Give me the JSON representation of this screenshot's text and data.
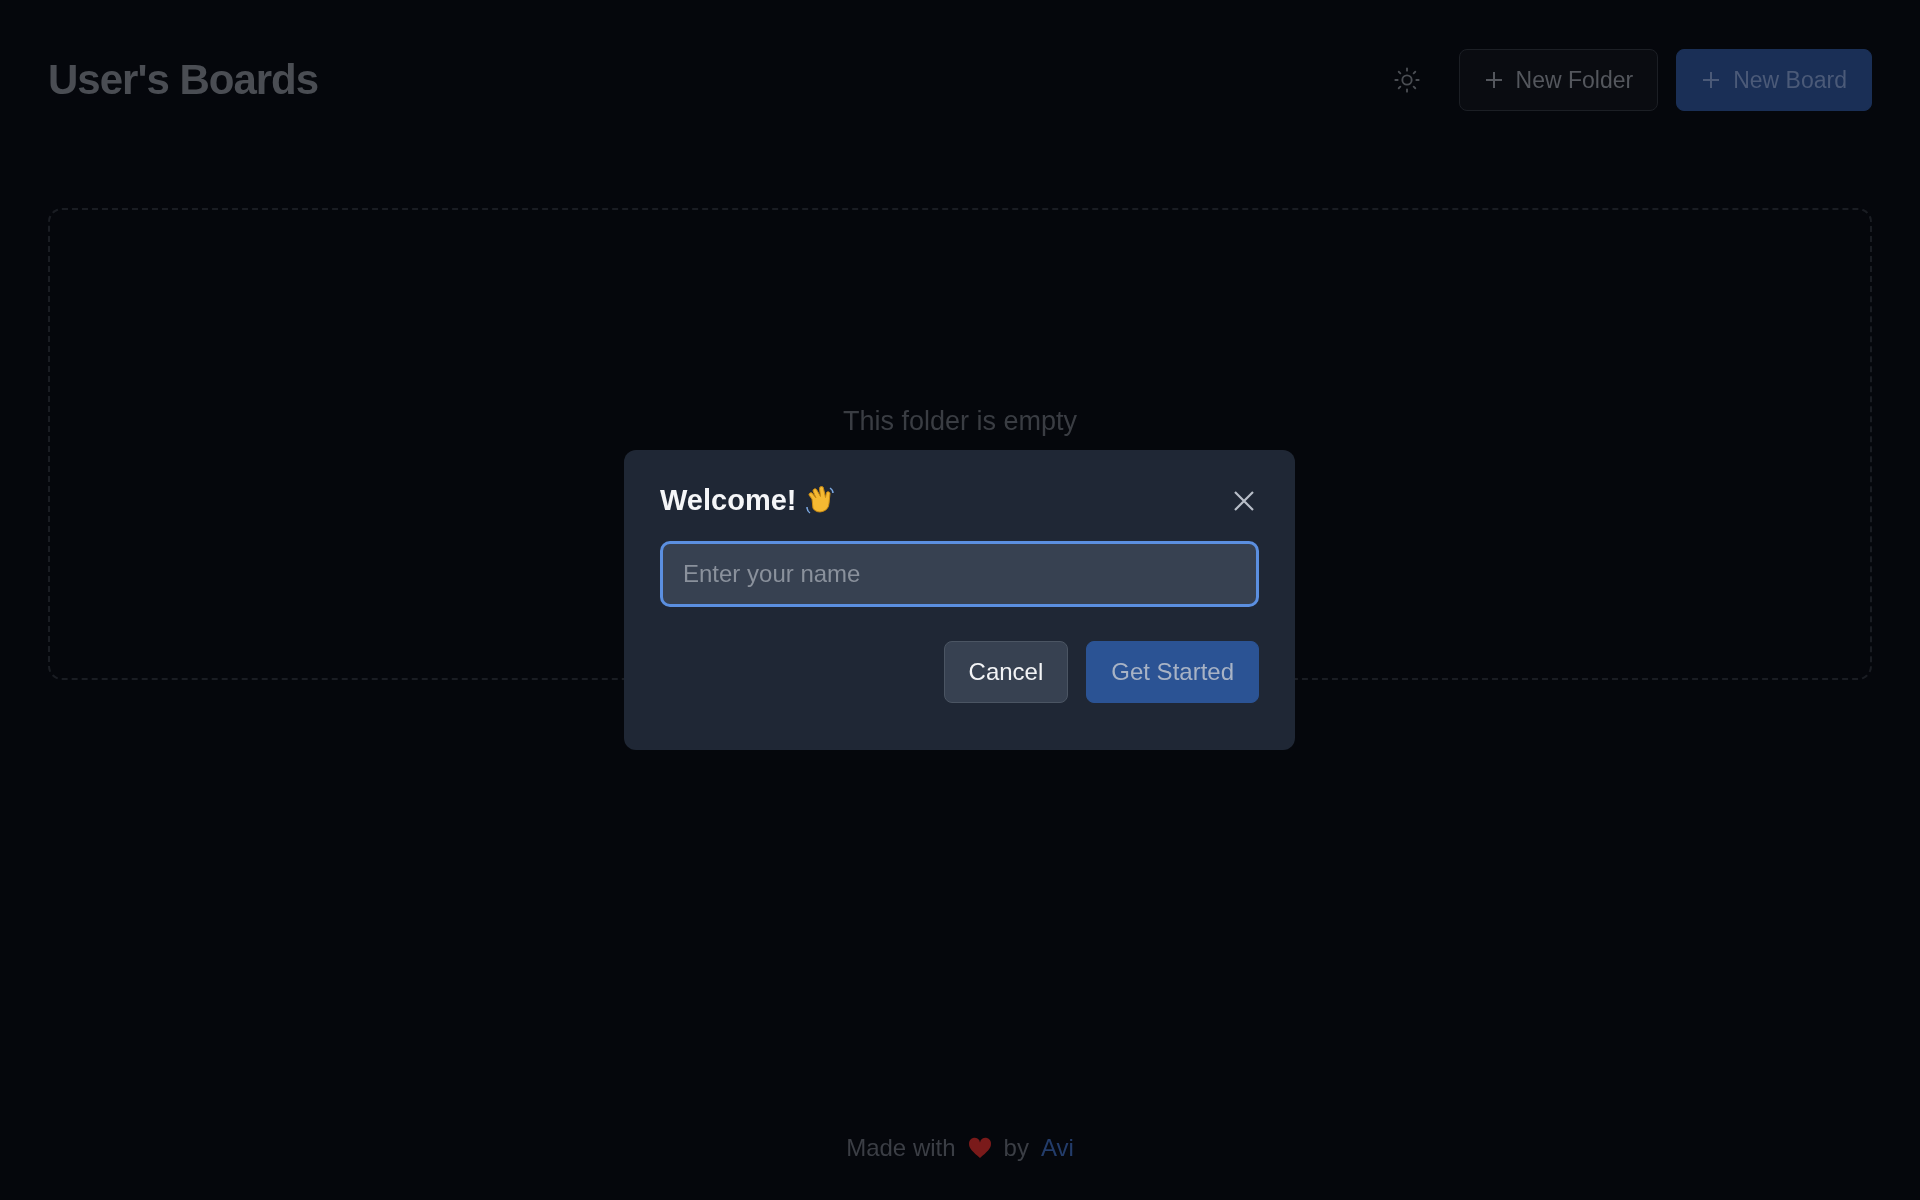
{
  "header": {
    "title": "User's Boards",
    "actions": [
      {
        "kind": "primary-off",
        "label": "New Folder"
      },
      {
        "kind": "primary",
        "label": "New Board"
      }
    ]
  },
  "empty_state": {
    "message": "This folder is empty"
  },
  "dialog": {
    "title": "Welcome!",
    "input": {
      "placeholder": "Enter your name",
      "focused": true
    },
    "buttons": [
      {
        "kind": "secondary",
        "label": "Cancel"
      },
      {
        "kind": "primary",
        "label": "Get Started"
      }
    ]
  },
  "footer": {
    "before": "Made with",
    "middle": "by",
    "link": "Avi"
  }
}
